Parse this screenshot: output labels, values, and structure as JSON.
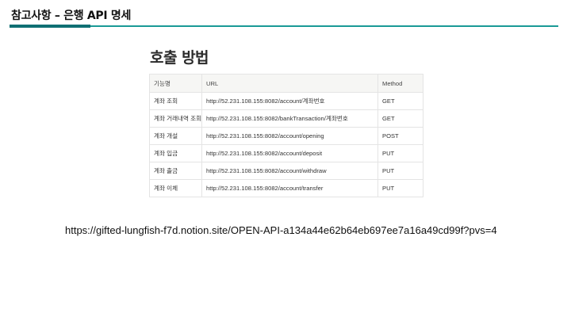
{
  "slide": {
    "title": "참고사항 – 은행 API 명세",
    "colors": {
      "accent_thin": "#1a9a96",
      "accent_thick": "#0f6f73"
    }
  },
  "embed": {
    "heading": "호출 방법",
    "table": {
      "headers": [
        "기능명",
        "URL",
        "Method"
      ],
      "rows": [
        [
          "계좌 조회",
          "http://52.231.108.155:8082/account/계좌번호",
          "GET"
        ],
        [
          "계좌 거래내역 조회",
          "http://52.231.108.155:8082/bankTransaction/계좌번호",
          "GET"
        ],
        [
          "계좌 개설",
          "http://52.231.108.155:8082/account/opening",
          "POST"
        ],
        [
          "계좌 입금",
          "http://52.231.108.155:8082/account/deposit",
          "PUT"
        ],
        [
          "계좌 출금",
          "http://52.231.108.155:8082/account/withdraw",
          "PUT"
        ],
        [
          "계좌 이체",
          "http://52.231.108.155:8082/account/transfer",
          "PUT"
        ]
      ]
    }
  },
  "link": {
    "text": "https://gifted-lungfish-f7d.notion.site/OPEN-API-a134a44e62b64eb697ee7a16a49cd99f?pvs=4"
  }
}
